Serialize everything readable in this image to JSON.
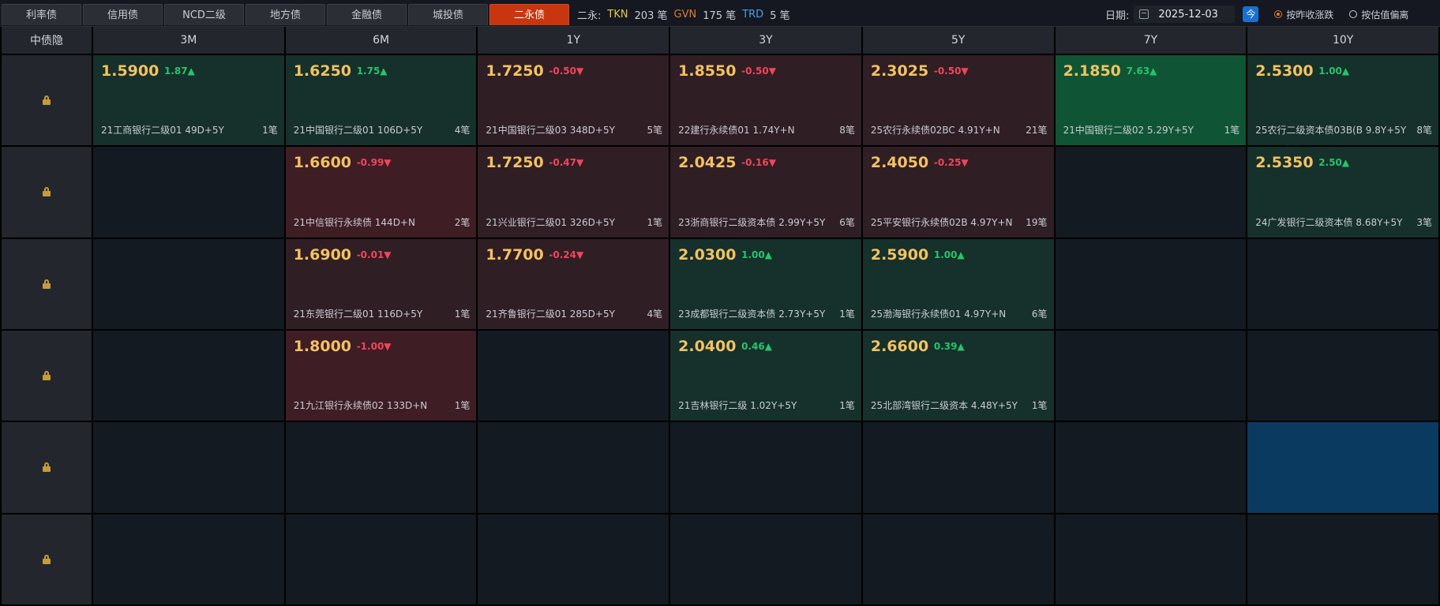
{
  "tabs": [
    "利率债",
    "信用债",
    "NCD二级",
    "地方债",
    "金融债",
    "城投债",
    "二永债"
  ],
  "summary": {
    "label": "二永:",
    "tkn_label": "TKN",
    "tkn_value": "203 笔",
    "gvn_label": "GVN",
    "gvn_value": "175 笔",
    "trd_label": "TRD",
    "trd_value": "5 笔"
  },
  "date": {
    "label": "日期:",
    "value": "2025-12-03",
    "today_btn": "今"
  },
  "radios": {
    "opt1": "按昨收涨跌",
    "opt2": "按估值偏离"
  },
  "headers": [
    "中债隐",
    "3M",
    "6M",
    "1Y",
    "3Y",
    "5Y",
    "7Y",
    "10Y"
  ],
  "rows": [
    [
      {
        "price": "1.5900",
        "chg": "1.87▲",
        "name": "21工商银行二级01 49D+5Y",
        "count": "1笔"
      },
      {
        "price": "1.6250",
        "chg": "1.75▲",
        "name": "21中国银行二级01 106D+5Y",
        "count": "4笔"
      },
      {
        "price": "1.7250",
        "chg": "-0.50▼",
        "name": "21中国银行二级03 348D+5Y",
        "count": "5笔"
      },
      {
        "price": "1.8550",
        "chg": "-0.50▼",
        "name": "22建行永续债01 1.74Y+N",
        "count": "8笔"
      },
      {
        "price": "2.3025",
        "chg": "-0.50▼",
        "name": "25农行永续债02BC 4.91Y+N",
        "count": "21笔"
      },
      {
        "price": "2.1850",
        "chg": "7.63▲",
        "name": "21中国银行二级02 5.29Y+5Y",
        "count": "1笔"
      },
      {
        "price": "2.5300",
        "chg": "1.00▲",
        "name": "25农行二级资本债03B(B 9.8Y+5Y",
        "count": "8笔"
      }
    ],
    [
      null,
      {
        "price": "1.6600",
        "chg": "-0.99▼",
        "name": "21中信银行永续债 144D+N",
        "count": "2笔"
      },
      {
        "price": "1.7250",
        "chg": "-0.47▼",
        "name": "21兴业银行二级01 326D+5Y",
        "count": "1笔"
      },
      {
        "price": "2.0425",
        "chg": "-0.16▼",
        "name": "23浙商银行二级资本债 2.99Y+5Y",
        "count": "6笔"
      },
      {
        "price": "2.4050",
        "chg": "-0.25▼",
        "name": "25平安银行永续债02B 4.97Y+N",
        "count": "19笔"
      },
      null,
      {
        "price": "2.5350",
        "chg": "2.50▲",
        "name": "24广发银行二级资本债 8.68Y+5Y",
        "count": "3笔"
      }
    ],
    [
      null,
      {
        "price": "1.6900",
        "chg": "-0.01▼",
        "name": "21东莞银行二级01 116D+5Y",
        "count": "1笔"
      },
      {
        "price": "1.7700",
        "chg": "-0.24▼",
        "name": "21齐鲁银行二级01 285D+5Y",
        "count": "4笔"
      },
      {
        "price": "2.0300",
        "chg": "1.00▲",
        "name": "23成都银行二级资本债 2.73Y+5Y",
        "count": "1笔"
      },
      {
        "price": "2.5900",
        "chg": "1.00▲",
        "name": "25渤海银行永续债01 4.97Y+N",
        "count": "6笔"
      },
      null,
      null
    ],
    [
      null,
      {
        "price": "1.8000",
        "chg": "-1.00▼",
        "name": "21九江银行永续债02 133D+N",
        "count": "1笔"
      },
      null,
      {
        "price": "2.0400",
        "chg": "0.46▲",
        "name": "21吉林银行二级 1.02Y+5Y",
        "count": "1笔"
      },
      {
        "price": "2.6600",
        "chg": "0.39▲",
        "name": "25北部湾银行二级资本 4.48Y+5Y",
        "count": "1笔"
      },
      null,
      null
    ],
    [
      null,
      null,
      null,
      null,
      null,
      null,
      null
    ],
    [
      null,
      null,
      null,
      null,
      null,
      null,
      null
    ]
  ],
  "colors": {
    "up_bg": "#16302b",
    "up_strong_bg": "#0f5535",
    "down_bg": "#301e25",
    "down_strong_bg": "#3e1d25",
    "price": "#f2c261",
    "pos": "#27c46a",
    "neg": "#f0455a",
    "active_tab": "#c8350f"
  }
}
